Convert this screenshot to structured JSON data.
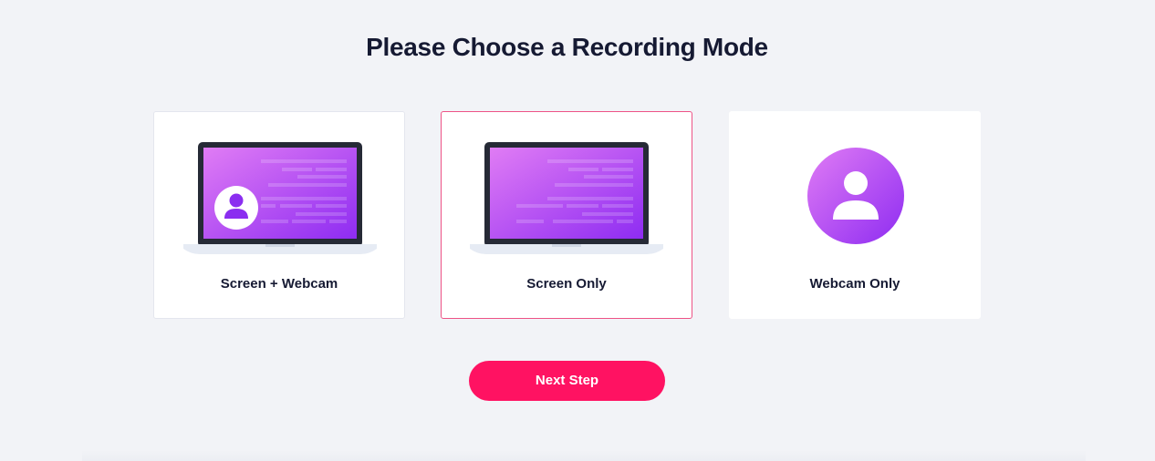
{
  "page": {
    "title": "Please Choose a Recording Mode"
  },
  "modes": [
    {
      "label": "Screen + Webcam",
      "icon": "laptop-with-avatar-icon",
      "selected": false
    },
    {
      "label": "Screen Only",
      "icon": "laptop-icon",
      "selected": true
    },
    {
      "label": "Webcam Only",
      "icon": "user-avatar-icon",
      "selected": false
    }
  ],
  "next_button": {
    "label": "Next Step"
  },
  "colors": {
    "background": "#f2f3f7",
    "title_text": "#161a33",
    "accent": "#ff1262",
    "selected_border": "#ee5386",
    "screen_gradient_start": "#e07cf4",
    "screen_gradient_end": "#8e2cf2",
    "laptop_bezel": "#262a36",
    "laptop_base": "#e6ebf4"
  }
}
